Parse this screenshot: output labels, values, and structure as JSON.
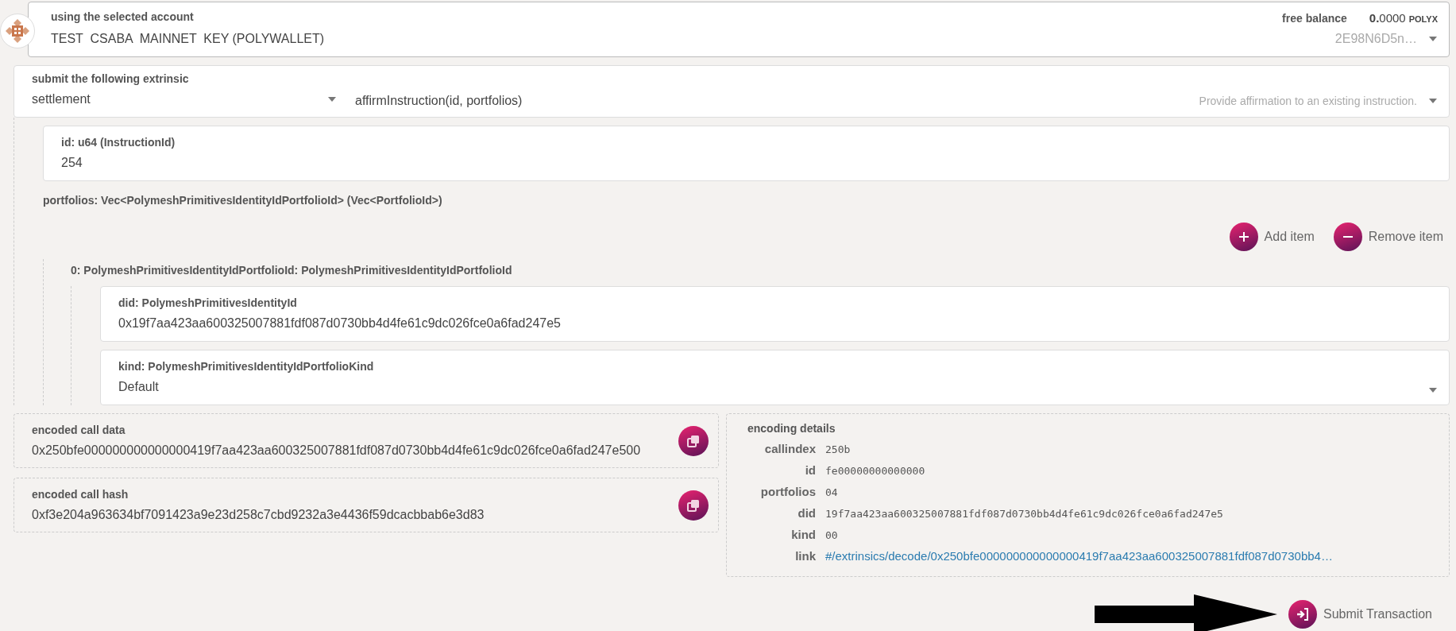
{
  "account": {
    "label": "using the selected account",
    "name": "TEST  CSABA  MAINNET  KEY (POLYWALLET)",
    "balance_label": "free balance",
    "balance_value": "**0.**0000",
    "balance_unit": "POLYX",
    "address": "2E98N6D5n…"
  },
  "extrinsic": {
    "label": "submit the following extrinsic",
    "section": "settlement",
    "method": "affirmInstruction(id, portfolios)",
    "description": "Provide affirmation to an existing instruction."
  },
  "params": [
    {
      "label": "id: u64 (InstructionId)",
      "value": "254"
    }
  ],
  "portfolios": {
    "label": "portfolios: Vec<PolymeshPrimitivesIdentityIdPortfolioId> (Vec<PortfolioId>)",
    "buttons": [
      {
        "kind": "add",
        "label": "Add item"
      },
      {
        "kind": "remove",
        "label": "Remove item"
      }
    ],
    "items": [
      {
        "label": "0: PolymeshPrimitivesIdentityIdPortfolioId: PolymeshPrimitivesIdentityIdPortfolioId",
        "fields": [
          {
            "kind": "input",
            "label": "did: PolymeshPrimitivesIdentityId",
            "value": "0x19f7aa423aa600325007881fdf087d0730bb4d4fe61c9dc026fce0a6fad247e5"
          },
          {
            "kind": "dropdown",
            "label": "kind: PolymeshPrimitivesIdentityIdPortfolioKind",
            "value": "Default"
          }
        ]
      }
    ]
  },
  "encoded": [
    {
      "label": "encoded call data",
      "value": "0x250bfe000000000000000419f7aa423aa600325007881fdf087d0730bb4d4fe61c9dc026fce0a6fad247e500"
    },
    {
      "label": "encoded call hash",
      "value": "0xf3e204a963634bf7091423a9e23d258c7cbd9232a3e4436f59dcacbbab6e3d83"
    }
  ],
  "encoding_details": {
    "title": "encoding details",
    "rows": [
      {
        "kind": "code",
        "key": "callindex",
        "value": "250b"
      },
      {
        "kind": "code",
        "key": "id",
        "value": "fe00000000000000"
      },
      {
        "kind": "code",
        "key": "portfolios",
        "value": "04"
      },
      {
        "kind": "code",
        "key": "did",
        "value": "19f7aa423aa600325007881fdf087d0730bb4d4fe61c9dc026fce0a6fad247e5"
      },
      {
        "kind": "code",
        "key": "kind",
        "value": "00"
      },
      {
        "kind": "link",
        "key": "link",
        "value": "#/extrinsics/decode/0x250bfe000000000000000419f7aa423aa600325007881fdf087d0730bb4…"
      }
    ]
  },
  "submit": {
    "label": "Submit Transaction"
  }
}
